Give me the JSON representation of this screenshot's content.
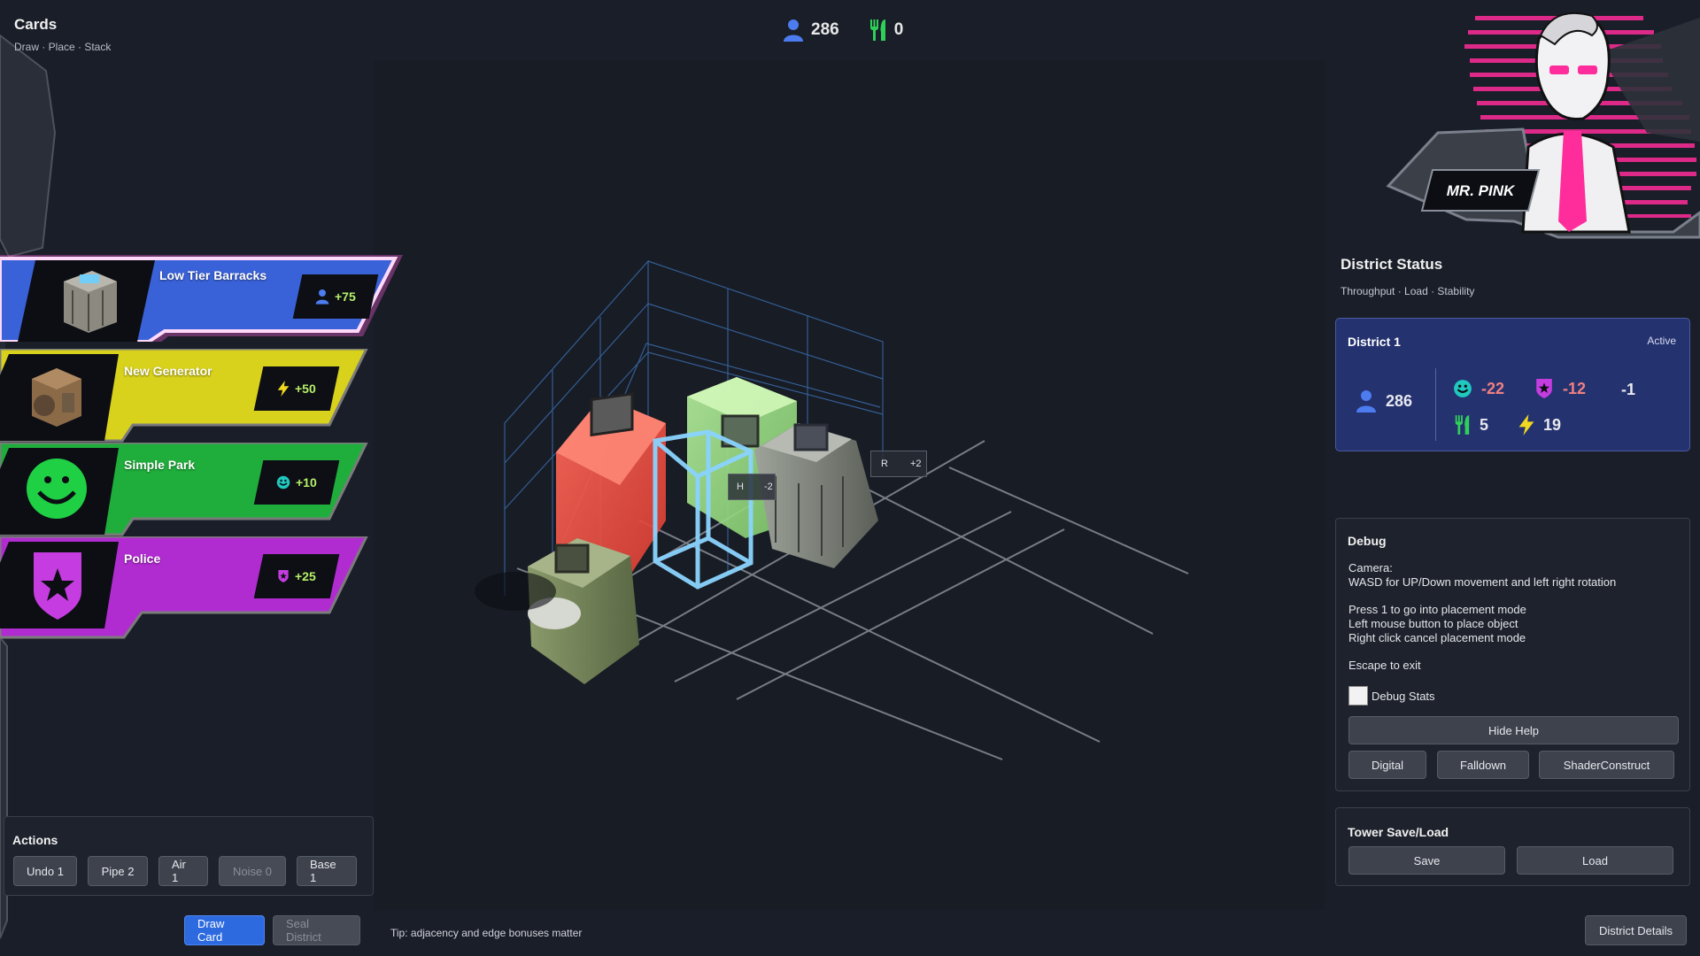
{
  "hud": {
    "population": "286",
    "food": "0"
  },
  "cards_panel": {
    "title": "Cards",
    "subtitle": "Draw · Place · Stack",
    "cards": [
      {
        "name": "Low Tier Barracks",
        "bonus": "+75",
        "bonus_icon": "person-icon",
        "color": "#3a62d8",
        "selected": true
      },
      {
        "name": "New Generator",
        "bonus": "+50",
        "bonus_icon": "lightning-icon",
        "color": "#d8d21c",
        "selected": false
      },
      {
        "name": "Simple Park",
        "bonus": "+10",
        "bonus_icon": "smiley-icon",
        "color": "#1fae3c",
        "selected": false
      },
      {
        "name": "Police",
        "bonus": "+25",
        "bonus_icon": "police-badge-icon",
        "color": "#b12cd0",
        "selected": false
      }
    ]
  },
  "actions": {
    "title": "Actions",
    "buttons": [
      "Undo 1",
      "Pipe 2",
      "Air 1",
      "Noise 0",
      "Base 1"
    ],
    "disabled": [
      "Noise 0"
    ]
  },
  "bottom_bar": {
    "draw_card": "Draw Card",
    "seal_district": "Seal District",
    "tip": "Tip: adjacency and edge bonuses matter",
    "district_details": "District Details"
  },
  "scene": {
    "tag_h": {
      "label": "H",
      "value": "-2"
    },
    "tag_r": {
      "label": "R",
      "value": "+2"
    }
  },
  "portrait": {
    "name": "MR. PINK",
    "accent": "#ff2d9b"
  },
  "district_status": {
    "title": "District Status",
    "subtitle": "Throughput · Load · Stability",
    "district": {
      "name": "District 1",
      "state": "Active",
      "population": "286",
      "happiness": "-22",
      "police": "-12",
      "other": "-1",
      "food": "5",
      "power": "19"
    }
  },
  "debug": {
    "title": "Debug",
    "lines": [
      "Camera:",
      "WASD for UP/Down movement and left right rotation",
      "Press 1 to go into placement mode",
      "Left mouse button to place object",
      "Right click cancel placement mode",
      "Escape to exit"
    ],
    "checkbox_label": "Debug Stats",
    "hide_help": "Hide Help",
    "modes": [
      "Digital",
      "Falldown",
      "ShaderConstruct"
    ]
  },
  "save_load": {
    "title": "Tower Save/Load",
    "save": "Save",
    "load": "Load"
  },
  "colors": {
    "primary_button": "#2d6ae0",
    "district_card": "#243270",
    "population_icon": "#4c7cf0",
    "food_icon": "#2fd05a",
    "happiness_icon": "#20c8c0",
    "police_icon": "#b12cd0",
    "power_icon": "#f0d820",
    "negative_value": "#f08080"
  }
}
